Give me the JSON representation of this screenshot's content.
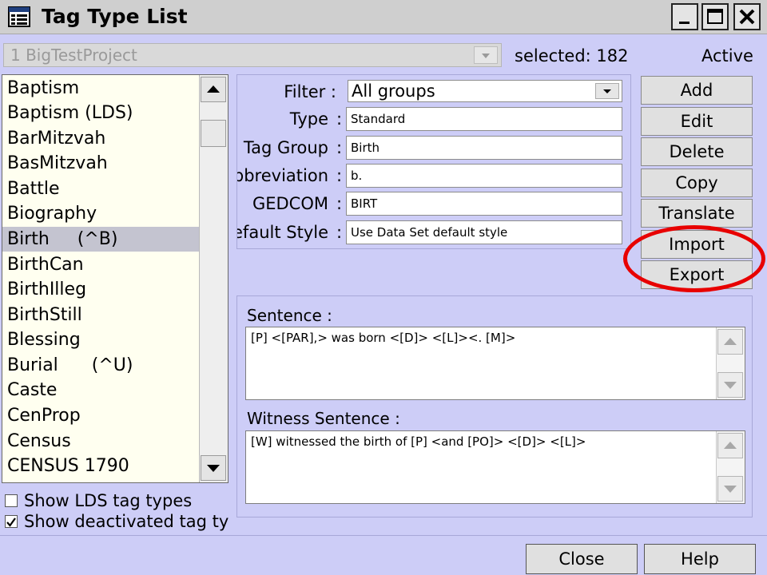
{
  "window": {
    "title": "Tag Type List",
    "icon": "list-window-icon"
  },
  "project": {
    "selected": "1 BigTestProject"
  },
  "status": {
    "selected_count": "selected: 182",
    "state": "Active"
  },
  "tag_list": {
    "items": [
      "Baptism",
      "Baptism (LDS)",
      "BarMitzvah",
      "BasMitzvah",
      "Battle",
      "Biography",
      "Birth     (^B)",
      "BirthCan",
      "BirthIlleg",
      "BirthStill",
      "Blessing",
      "Burial      (^U)",
      "Caste",
      "CenProp",
      "Census",
      "CENSUS 1790"
    ],
    "selected_item": "Birth     (^B)"
  },
  "options": {
    "show_lds": {
      "label": "Show LDS tag types",
      "checked": false
    },
    "show_deactivated": {
      "label": "Show deactivated tag type",
      "checked": true
    }
  },
  "details": {
    "filter_label": "Filter :",
    "filter_value": "All groups",
    "fields": [
      {
        "label": "Type",
        "value": "Standard"
      },
      {
        "label": "Tag Group",
        "value": "Birth"
      },
      {
        "label": "bbreviation",
        "value": "b."
      },
      {
        "label": "GEDCOM",
        "value": "BIRT"
      },
      {
        "label": "efault Style",
        "value": "Use Data Set default style"
      }
    ]
  },
  "buttons": {
    "add": "Add",
    "edit": "Edit",
    "delete": "Delete",
    "copy": "Copy",
    "translate": "Translate",
    "import": "Import",
    "export": "Export",
    "close": "Close",
    "help": "Help"
  },
  "sentence": {
    "label": "Sentence :",
    "text": "[P] <[PAR],> was born <[D]> <[L]><.  [M]>"
  },
  "witness_sentence": {
    "label": "Witness Sentence :",
    "text": "[W] witnessed the birth of [P] <and [PO]> <[D]> <[L]>"
  },
  "annotation": {
    "color": "#e80000"
  }
}
